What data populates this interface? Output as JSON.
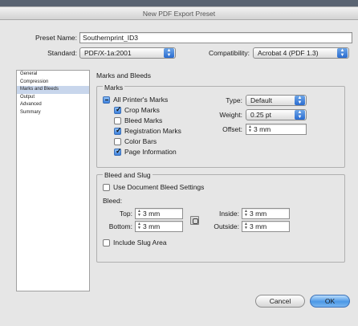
{
  "window": {
    "title": "New PDF Export Preset"
  },
  "preset": {
    "label": "Preset Name:",
    "value": "Southernprint_ID3"
  },
  "standard": {
    "label": "Standard:",
    "value": "PDF/X-1a:2001"
  },
  "compatibility": {
    "label": "Compatibility:",
    "value": "Acrobat 4 (PDF 1.3)"
  },
  "sidebar": {
    "items": [
      {
        "label": "General"
      },
      {
        "label": "Compression"
      },
      {
        "label": "Marks and Bleeds",
        "selected": true
      },
      {
        "label": "Output"
      },
      {
        "label": "Advanced"
      },
      {
        "label": "Summary"
      }
    ]
  },
  "panel": {
    "title": "Marks and Bleeds"
  },
  "marks": {
    "title": "Marks",
    "all_printers_marks": "All Printer's Marks",
    "crop_marks": "Crop Marks",
    "bleed_marks": "Bleed Marks",
    "registration_marks": "Registration Marks",
    "color_bars": "Color Bars",
    "page_information": "Page Information",
    "type_label": "Type:",
    "type_value": "Default",
    "weight_label": "Weight:",
    "weight_value": "0.25 pt",
    "offset_label": "Offset:",
    "offset_value": "3 mm"
  },
  "bleed": {
    "title": "Bleed and Slug",
    "use_document": "Use Document Bleed Settings",
    "bleed_label": "Bleed:",
    "top_label": "Top:",
    "top_value": "3 mm",
    "bottom_label": "Bottom:",
    "bottom_value": "3 mm",
    "inside_label": "Inside:",
    "inside_value": "3 mm",
    "outside_label": "Outside:",
    "outside_value": "3 mm",
    "include_slug": "Include Slug Area"
  },
  "buttons": {
    "cancel": "Cancel",
    "ok": "OK"
  }
}
